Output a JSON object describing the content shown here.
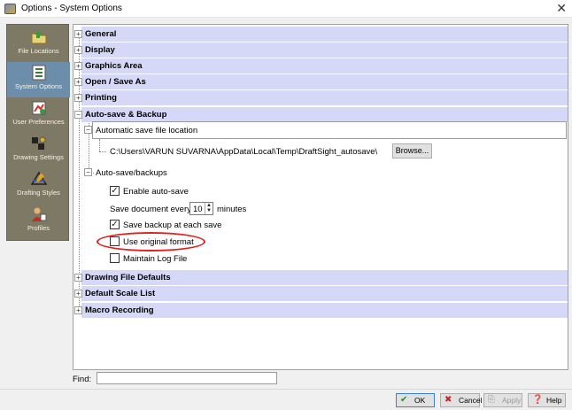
{
  "window": {
    "title": "Options - System Options",
    "close_glyph": "✕"
  },
  "sidebar": {
    "items": [
      {
        "label": "File Locations",
        "icon": "folder-icon"
      },
      {
        "label": "System Options",
        "icon": "system-options-icon",
        "selected": true
      },
      {
        "label": "User Preferences",
        "icon": "user-preferences-icon"
      },
      {
        "label": "Drawing Settings",
        "icon": "drawing-settings-icon"
      },
      {
        "label": "Drafting Styles",
        "icon": "drafting-styles-icon"
      },
      {
        "label": "Profiles",
        "icon": "profiles-icon"
      }
    ]
  },
  "tree": {
    "sections": [
      {
        "label": "General",
        "expander": "+"
      },
      {
        "label": "Display",
        "expander": "+"
      },
      {
        "label": "Graphics Area",
        "expander": "+"
      },
      {
        "label": "Open / Save As",
        "expander": "+"
      },
      {
        "label": "Printing",
        "expander": "+"
      },
      {
        "label": "Auto-save & Backup",
        "expander": "−"
      },
      {
        "label": "Drawing File Defaults",
        "expander": "+"
      },
      {
        "label": "Default Scale List",
        "expander": "+"
      },
      {
        "label": "Macro Recording",
        "expander": "+"
      }
    ],
    "autosave": {
      "location_header": "Automatic save file location",
      "path": "C:\\Users\\VARUN SUVARNA\\AppData\\Local\\Temp\\DraftSight_autosave\\",
      "browse_label": "Browse...",
      "backups_label": "Auto-save/backups",
      "enable_autosave": {
        "label": "Enable auto-save",
        "checked": true
      },
      "save_every": {
        "prefix": "Save document every",
        "value": "10",
        "suffix": "minutes"
      },
      "save_backup": {
        "label": "Save backup at each save",
        "checked": true
      },
      "use_original": {
        "label": "Use original format",
        "checked": false
      },
      "maintain_log": {
        "label": "Maintain Log File",
        "checked": false
      }
    }
  },
  "find": {
    "label": "Find:",
    "value": ""
  },
  "buttons": {
    "ok": {
      "label": "OK",
      "icon": "check-icon"
    },
    "cancel": {
      "label": "Cancel",
      "icon": "x-icon"
    },
    "apply": {
      "label": "Apply",
      "icon": "apply-icon"
    },
    "help": {
      "label": "Help",
      "icon": "help-icon"
    }
  },
  "colors": {
    "section_bg": "#d5d8f7",
    "sidebar_bg": "#7d7964",
    "selected_bg": "#6d8eab",
    "highlight_ellipse": "#e0201e"
  },
  "checkmark_glyph": "✓",
  "spin_up": "▲",
  "spin_down": "▼"
}
